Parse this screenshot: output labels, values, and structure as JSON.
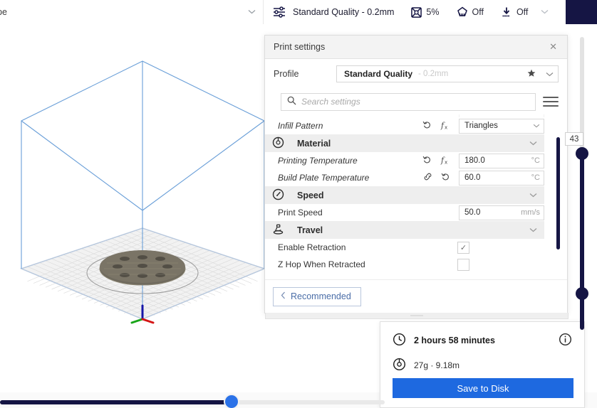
{
  "topbar": {
    "machine_label": "pe",
    "machine_chevron": "chevron-down-icon",
    "profile_name": "Standard Quality - 0.2mm",
    "settings_icon": "sliders-icon",
    "infill": {
      "icon": "infill-icon",
      "value": "5%"
    },
    "support": {
      "icon": "support-icon",
      "value": "Off"
    },
    "adhesion": {
      "icon": "adhesion-icon",
      "value": "Off"
    },
    "trailing_chevron": "chevron-down-icon"
  },
  "print_settings": {
    "title": "Print settings",
    "close_label": "✕",
    "profile_row_label": "Profile",
    "profile_value": "Standard Quality",
    "profile_sub": "- 0.2mm",
    "favorite_icon": "star-icon",
    "profile_chevron": "chevron-down-icon",
    "search_placeholder": "Search settings",
    "search_icon": "search-icon",
    "menu_icon": "hamburger-menu-icon",
    "rows": [
      {
        "kind": "setting",
        "label": "Infill Pattern",
        "icons": [
          "revert-icon",
          "function-icon"
        ],
        "control": "combo",
        "value": "Triangles",
        "chevron": "chevron-down-icon"
      },
      {
        "kind": "category",
        "label": "Material",
        "icon": "material-spool-icon",
        "chevron": "chevron-down-icon"
      },
      {
        "kind": "setting",
        "label": "Printing Temperature",
        "icons": [
          "revert-icon",
          "function-icon"
        ],
        "control": "value",
        "value": "180.0",
        "unit": "°C"
      },
      {
        "kind": "setting",
        "label": "Build Plate Temperature",
        "icons": [
          "link-icon",
          "revert-icon"
        ],
        "control": "value",
        "value": "60.0",
        "unit": "°C"
      },
      {
        "kind": "category",
        "label": "Speed",
        "icon": "speedometer-icon",
        "chevron": "chevron-down-icon"
      },
      {
        "kind": "setting",
        "label": "Print Speed",
        "label_style": "plain",
        "icons": [],
        "control": "value",
        "value": "50.0",
        "unit": "mm/s"
      },
      {
        "kind": "category",
        "label": "Travel",
        "icon": "travel-icon",
        "chevron": "chevron-down-icon"
      },
      {
        "kind": "setting",
        "label": "Enable Retraction",
        "label_style": "plain",
        "icons": [],
        "control": "checkbox",
        "checked": true,
        "check_glyph": "✓"
      },
      {
        "kind": "setting",
        "label": "Z Hop When Retracted",
        "label_style": "plain",
        "icons": [],
        "control": "checkbox",
        "checked": false,
        "check_glyph": ""
      }
    ],
    "footer": {
      "recommended_label": "Recommended",
      "back_chevron": "chevron-left-icon"
    }
  },
  "job_card": {
    "time_icon": "clock-icon",
    "time_text": "2 hours 58 minutes",
    "material_icon": "material-spool-icon",
    "material_text": "27g · 9.18m",
    "info_icon": "info-icon",
    "save_label": "Save to Disk"
  },
  "layer_slider": {
    "value": "43",
    "name": "layer-view-slider"
  },
  "bottom_slider": {
    "name": "simulation-path-slider"
  },
  "colors": {
    "accent_blue": "#1e69e0",
    "dark_navy": "#151544",
    "link_blue": "#4a6da7",
    "category_bg": "#eeeeee",
    "build_volume_line": "#6a9fd8"
  }
}
